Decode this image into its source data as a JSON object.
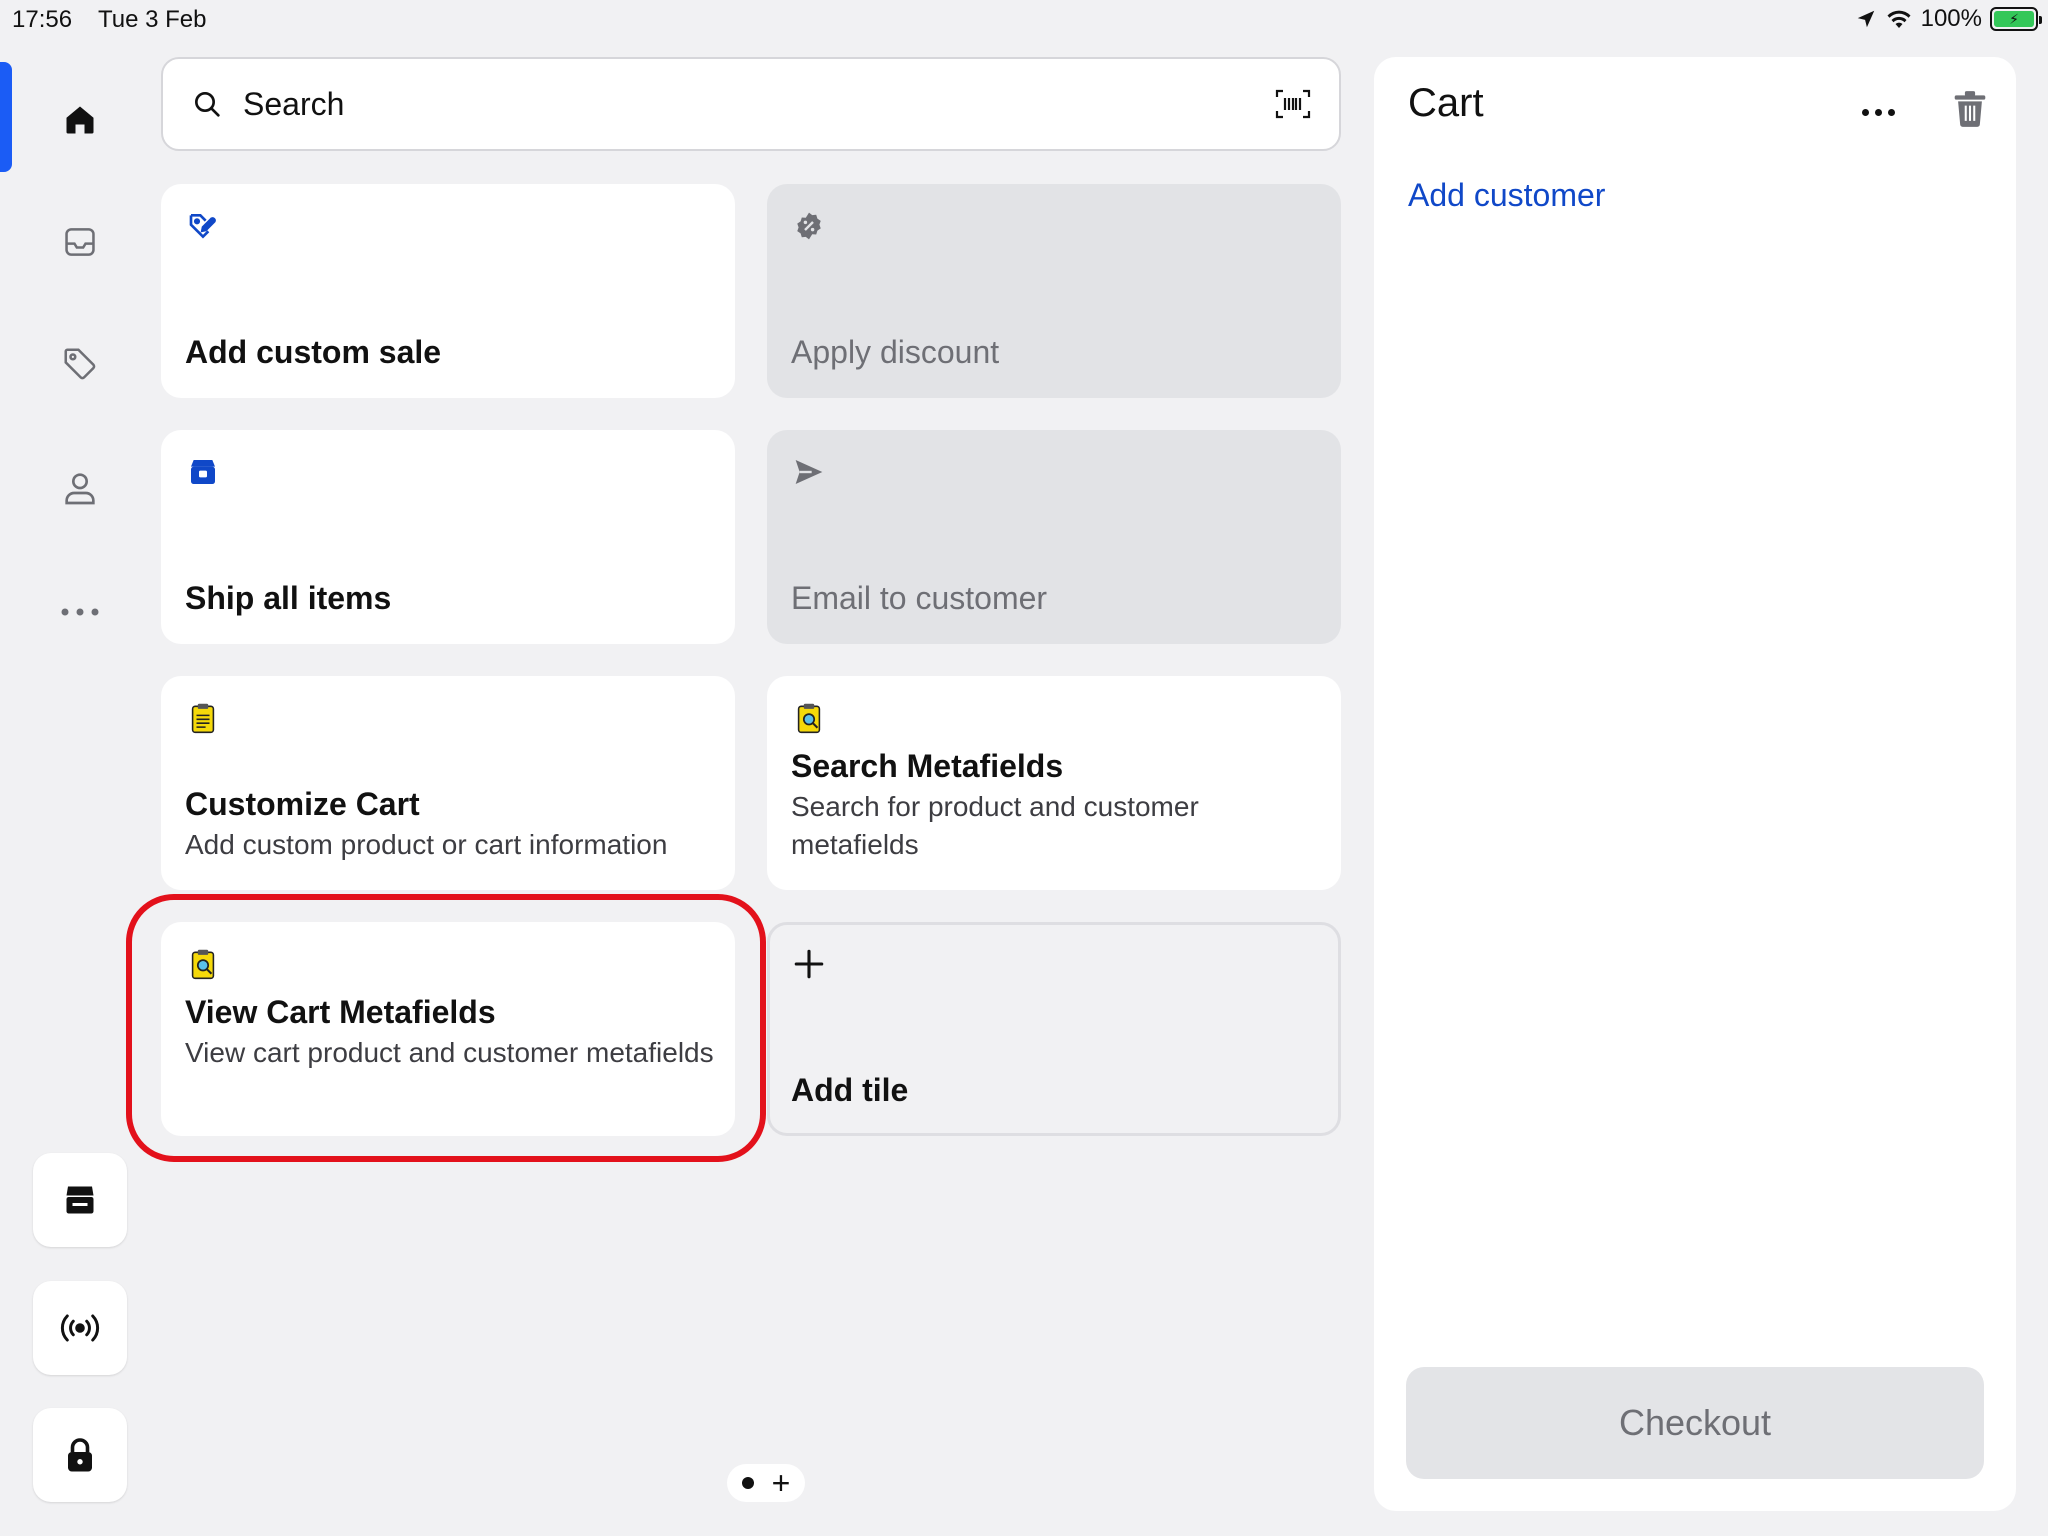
{
  "status_bar": {
    "time": "17:56",
    "date": "Tue 3 Feb",
    "battery": "100%"
  },
  "sidebar": {
    "items": [
      {
        "name": "home-icon",
        "active": true
      },
      {
        "name": "inbox-icon",
        "active": false
      },
      {
        "name": "tag-icon",
        "active": false
      },
      {
        "name": "person-icon",
        "active": false
      },
      {
        "name": "more-horizontal-icon",
        "active": false
      }
    ],
    "bottom_buttons": [
      {
        "name": "store-icon"
      },
      {
        "name": "broadcast-icon"
      },
      {
        "name": "lock-icon"
      }
    ]
  },
  "search": {
    "placeholder": "Search"
  },
  "tiles": [
    {
      "title": "Add custom sale",
      "subtitle": "",
      "icon": "tag-edit-icon",
      "enabled": true
    },
    {
      "title": "Apply discount",
      "subtitle": "",
      "icon": "discount-badge-icon",
      "enabled": false
    },
    {
      "title": "Ship all items",
      "subtitle": "",
      "icon": "package-icon",
      "enabled": true
    },
    {
      "title": "Email to customer",
      "subtitle": "",
      "icon": "send-icon",
      "enabled": false
    },
    {
      "title": "Customize Cart",
      "subtitle": "Add custom product or cart information",
      "icon": "clipboard-icon",
      "enabled": true
    },
    {
      "title": "Search Metafields",
      "subtitle": "Search for product and customer metafields",
      "icon": "clipboard-search-icon",
      "enabled": true
    },
    {
      "title": "View Cart Metafields",
      "subtitle": "View cart product and customer metafields",
      "icon": "clipboard-search-icon",
      "enabled": true,
      "highlighted": true
    },
    {
      "title": "Add tile",
      "subtitle": "",
      "icon": "plus-icon",
      "enabled": true
    }
  ],
  "cart": {
    "title": "Cart",
    "add_customer": "Add customer",
    "checkout": "Checkout"
  },
  "colors": {
    "accent": "#1b5cf5",
    "link": "#1048c8",
    "highlight": "#e3111b",
    "background": "#f1f1f3"
  }
}
